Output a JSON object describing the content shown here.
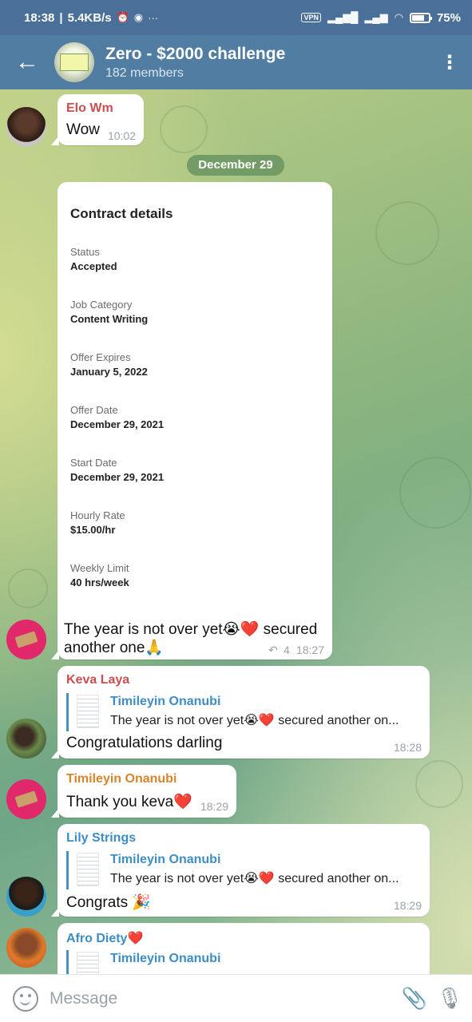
{
  "status_bar": {
    "time": "18:38",
    "speed": "5.4KB/s",
    "vpn": "VPN",
    "battery_percent": "75%",
    "battery_level": 0.75
  },
  "header": {
    "title": "Zero - $2000 challenge",
    "members": "182 members"
  },
  "messages": {
    "m1": {
      "sender": "Elo Wm",
      "text": "Wow",
      "time": "10:02"
    },
    "date": "December 29",
    "m2": {
      "contract": {
        "title": "Contract details",
        "fields": [
          {
            "label": "Status",
            "value": "Accepted"
          },
          {
            "label": "Job Category",
            "value": "Content Writing"
          },
          {
            "label": "Offer Expires",
            "value": "January 5, 2022"
          },
          {
            "label": "Offer Date",
            "value": "December 29, 2021"
          },
          {
            "label": "Start Date",
            "value": "December 29, 2021"
          },
          {
            "label": "Hourly Rate",
            "value": "$15.00/hr"
          },
          {
            "label": "Weekly Limit",
            "value": "40 hrs/week"
          }
        ]
      },
      "text_line1": "The year is not over yet😭❤️ secured",
      "text_line2": "another one🙏",
      "forwards": "4",
      "time": "18:27"
    },
    "m3": {
      "sender": "Keva Laya",
      "reply_name": "Timileyin Onanubi",
      "reply_text": "The year is not over yet😭❤️ secured another on...",
      "text": "Congratulations darling",
      "time": "18:28"
    },
    "m4": {
      "sender": "Timileyin Onanubi",
      "text": "Thank you keva❤️",
      "time": "18:29"
    },
    "m5": {
      "sender": "Lily Strings",
      "reply_name": "Timileyin Onanubi",
      "reply_text": "The year is not over yet😭❤️ secured another on...",
      "text": "Congrats 🎉",
      "time": "18:29"
    },
    "m6": {
      "sender": "Afro Diety❤️",
      "reply_name": "Timileyin Onanubi"
    }
  },
  "input": {
    "placeholder": "Message"
  },
  "colors": {
    "header": "#517da2",
    "elo": "#c94f4f",
    "keva": "#c94f4f",
    "timileyin": "#d9842a",
    "lily": "#3e8dc4",
    "afro": "#3e8dc4"
  }
}
